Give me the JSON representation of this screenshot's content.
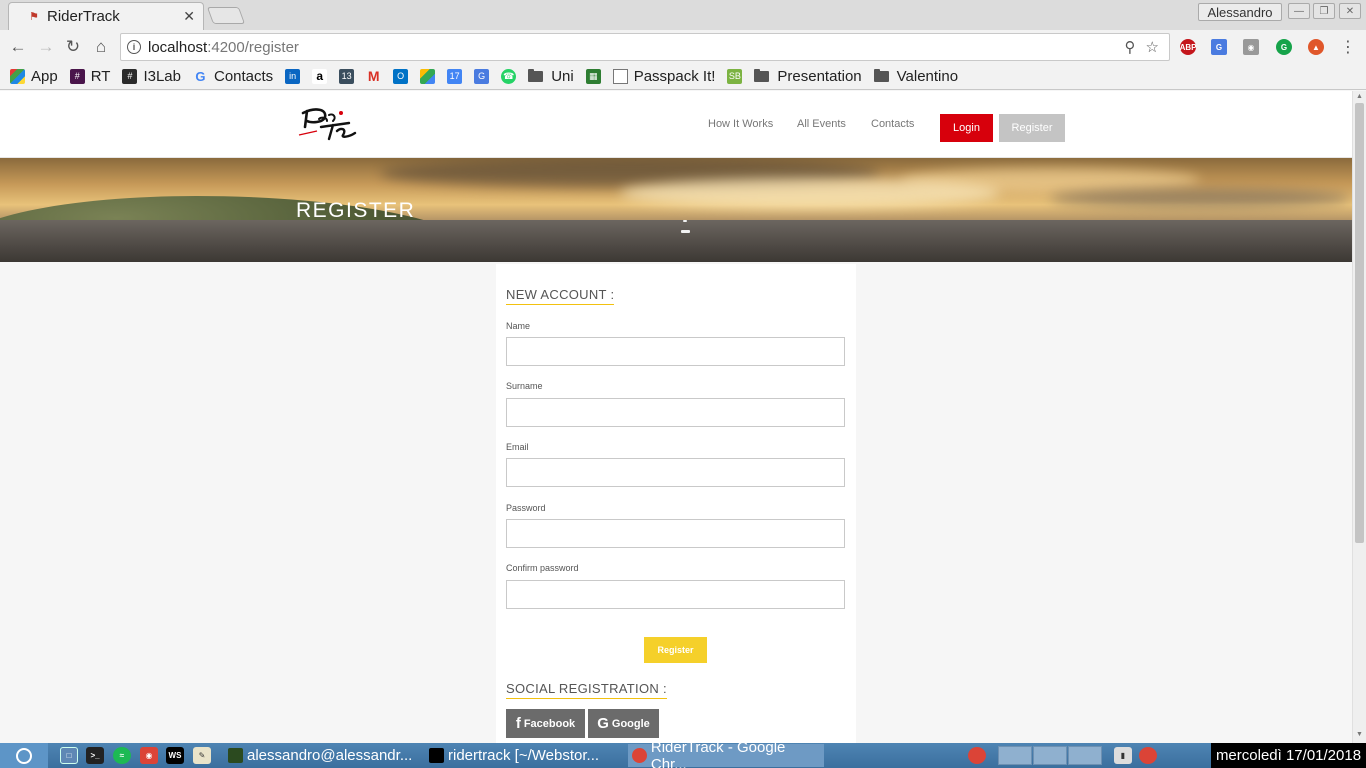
{
  "browser": {
    "tab_title": "RiderTrack",
    "profile_name": "Alessandro",
    "url_host": "localhost",
    "url_path": ":4200/register"
  },
  "bookmarks": [
    {
      "label": "App",
      "icon": "apps-grid-icon"
    },
    {
      "label": "RT",
      "icon": "hash-icon"
    },
    {
      "label": "I3Lab",
      "icon": "hash-icon"
    },
    {
      "label": "Contacts",
      "icon": "google-icon"
    },
    {
      "label": "Uni",
      "icon": "folder-icon"
    },
    {
      "label": "Passpack It!",
      "icon": "page-icon"
    },
    {
      "label": "Presentation",
      "icon": "folder-icon"
    },
    {
      "label": "Valentino",
      "icon": "folder-icon"
    }
  ],
  "site": {
    "nav": {
      "how_it_works": "How It Works",
      "all_events": "All Events",
      "contacts": "Contacts",
      "login": "Login",
      "register": "Register"
    },
    "hero_title": "REGISTER",
    "form": {
      "new_account_title": "NEW ACCOUNT :",
      "name_label": "Name",
      "surname_label": "Surname",
      "email_label": "Email",
      "password_label": "Password",
      "confirm_password_label": "Confirm password",
      "submit_label": "Register",
      "social_title": "SOCIAL REGISTRATION :",
      "facebook_label": "Facebook",
      "google_label": "Google"
    },
    "colors": {
      "login_button": "#d7000c",
      "register_nav_button": "#c4c4c4",
      "accent_yellow": "#f5d02a",
      "social_button": "#6b6b6b"
    }
  },
  "taskbar": {
    "tasks": [
      {
        "label": "alessandro@alessandr..."
      },
      {
        "label": "ridertrack [~/Webstor..."
      },
      {
        "label": "RiderTrack - Google Chr..."
      }
    ],
    "clock": "mercoledì 17/01/2018"
  }
}
